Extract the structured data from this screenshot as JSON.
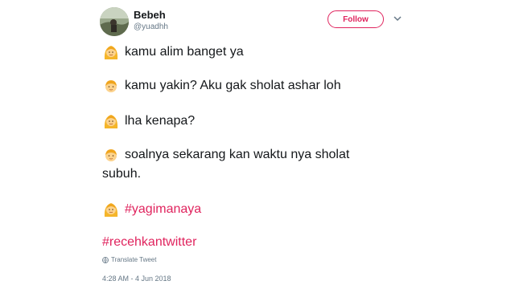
{
  "user": {
    "name": "Bebeh",
    "handle": "@yuadhh"
  },
  "follow_label": "Follow",
  "tweet": {
    "lines": [
      {
        "icon": "blonde-woman-emoji-icon",
        "text": "kamu alim banget ya"
      },
      {
        "icon": "blonde-man-emoji-icon",
        "text": "kamu yakin? Aku gak sholat ashar loh"
      },
      {
        "icon": "blonde-woman-emoji-icon",
        "text": "lha kenapa?"
      },
      {
        "icon": "blonde-man-emoji-icon",
        "text": "soalnya sekarang kan waktu nya sholat"
      },
      {
        "icon": "none",
        "text": "subuh."
      },
      {
        "icon": "blonde-woman-emoji-icon",
        "text": "#yagimanaya"
      }
    ],
    "hashtag2": "#recehkantwitter"
  },
  "translate_label": "Translate Tweet",
  "timestamp": "4:28 AM - 4 Jun 2018",
  "colors": {
    "accent": "#e0245e",
    "text": "#14171a",
    "muted": "#657786"
  }
}
